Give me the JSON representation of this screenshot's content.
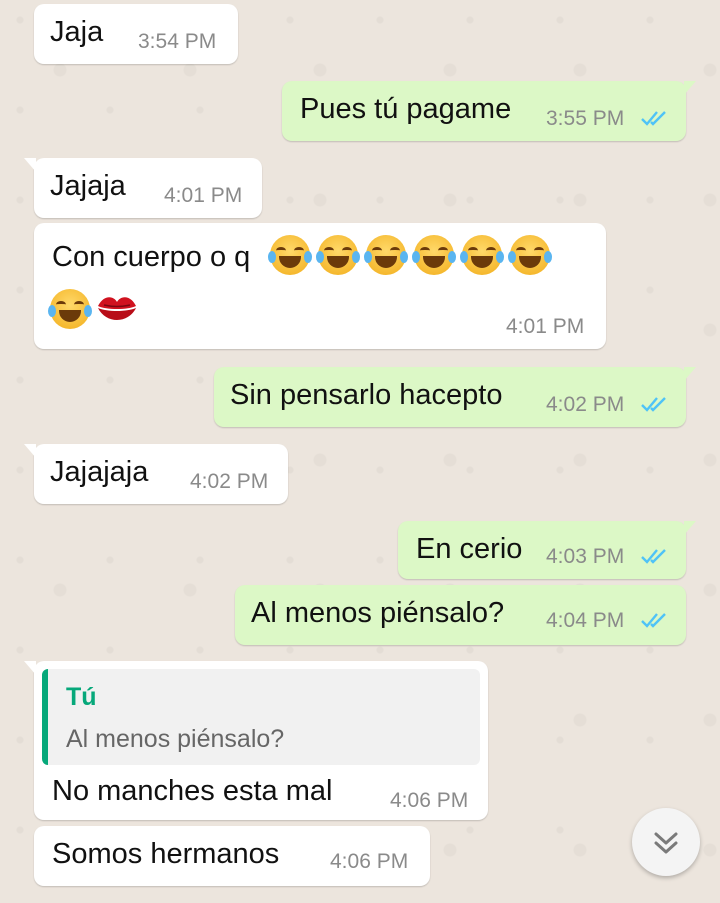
{
  "messages": [
    {
      "text": "Jaja",
      "time": "3:54 PM"
    },
    {
      "text": "Pues tú pagame",
      "time": "3:55 PM"
    },
    {
      "text": "Jajaja",
      "time": "4:01 PM"
    },
    {
      "text": "Con cuerpo o q",
      "time": "4:01 PM"
    },
    {
      "text": "Sin pensarlo hacepto",
      "time": "4:02 PM"
    },
    {
      "text": "Jajajaja",
      "time": "4:02 PM"
    },
    {
      "text": "En cerio",
      "time": "4:03 PM"
    },
    {
      "text": "Al menos piénsalo?",
      "time": "4:04 PM"
    },
    {
      "text": "No manches esta mal",
      "time": "4:06 PM",
      "quote_author": "Tú",
      "quote_text": "Al menos piénsalo?"
    },
    {
      "text": "Somos hermanos",
      "time": "4:06 PM"
    }
  ],
  "colors": {
    "incoming_bubble": "#ffffff",
    "outgoing_bubble": "#dcf8c6",
    "read_ticks": "#4fc3f7",
    "quote_accent": "#06a87a",
    "background": "#ece5dd"
  },
  "icons": {
    "read_receipt": "double-check-icon",
    "scroll_down": "chevron-double-down-icon",
    "laugh_emoji": "face-with-tears-of-joy-icon",
    "kiss_emoji": "kiss-mark-icon"
  }
}
